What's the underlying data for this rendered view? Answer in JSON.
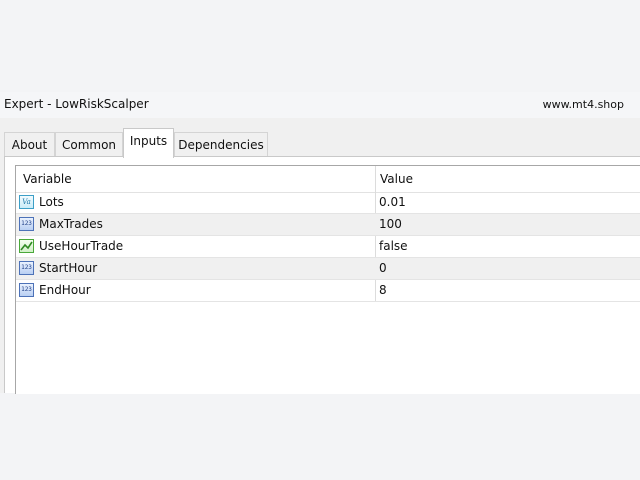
{
  "window": {
    "title": "Expert - LowRiskScalper",
    "brand": "www.mt4.shop"
  },
  "tabs": [
    {
      "label": "About",
      "active": false
    },
    {
      "label": "Common",
      "active": false
    },
    {
      "label": "Inputs",
      "active": true
    },
    {
      "label": "Dependencies",
      "active": false
    }
  ],
  "table": {
    "headers": {
      "variable": "Variable",
      "value": "Value"
    },
    "rows": [
      {
        "name": "Lots",
        "value": "0.01",
        "icon": "double-type-icon",
        "icon_text": "Va"
      },
      {
        "name": "MaxTrades",
        "value": "100",
        "icon": "integer-type-icon",
        "icon_text": "123"
      },
      {
        "name": "UseHourTrade",
        "value": "false",
        "icon": "bool-type-icon"
      },
      {
        "name": "StartHour",
        "value": "0",
        "icon": "integer-type-icon",
        "icon_text": "123"
      },
      {
        "name": "EndHour",
        "value": "8",
        "icon": "integer-type-icon",
        "icon_text": "123"
      }
    ]
  },
  "colors": {
    "background": "#f3f4f6",
    "dialog": "#f0f0f0",
    "panel": "#ffffff",
    "alt_row": "#f0f0f0"
  }
}
